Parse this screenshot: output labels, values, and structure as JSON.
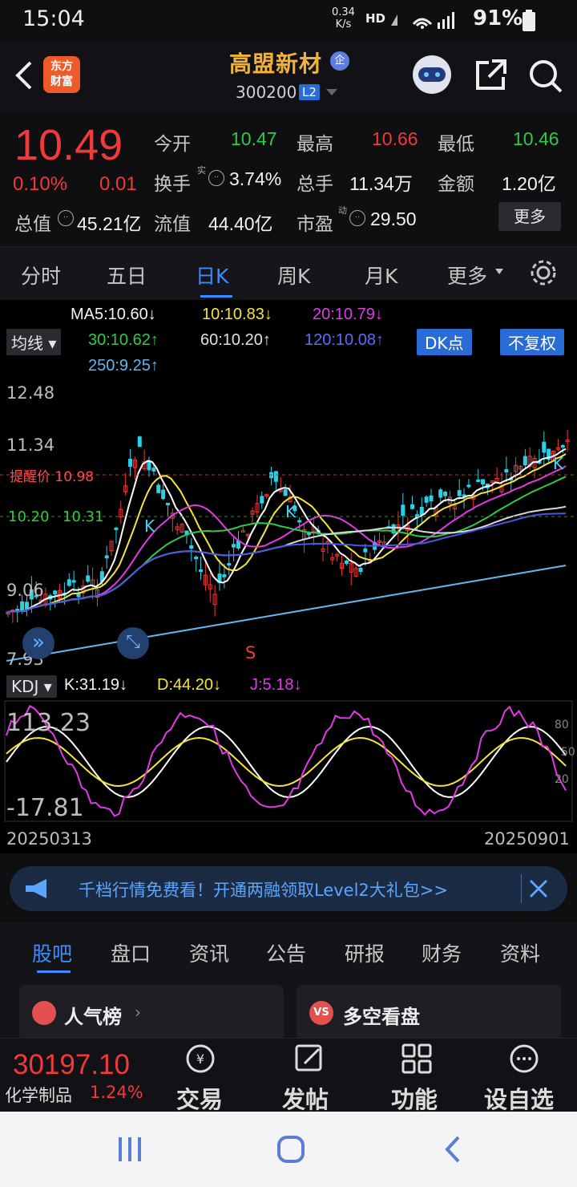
{
  "status": {
    "time": "15:04",
    "net_speed": "0.34",
    "net_unit": "K/s",
    "hd": "HD",
    "battery": "91%"
  },
  "header": {
    "brand_line1": "东方",
    "brand_line2": "财富",
    "stock_name": "高盟新材",
    "name_badge": "企",
    "stock_code": "300200",
    "l2_badge": "L2"
  },
  "quote": {
    "price": "10.49",
    "change_pct": "0.10%",
    "change": "0.01",
    "open_label": "今开",
    "open": "10.47",
    "high_label": "最高",
    "high": "10.66",
    "low_label": "最低",
    "low": "10.46",
    "turnover_label": "换手",
    "turnover_sup": "实",
    "turnover": "3.74%",
    "volume_label": "总手",
    "volume": "11.34万",
    "amount_label": "金额",
    "amount": "1.20亿",
    "mktcap_label": "总值",
    "mktcap": "45.21亿",
    "float_label": "流值",
    "float": "44.40亿",
    "pe_label": "市盈",
    "pe_sup": "动",
    "pe": "29.50",
    "more_button": "更多"
  },
  "period_tabs": [
    "分时",
    "五日",
    "日K",
    "周K",
    "月K",
    "更多"
  ],
  "ma_legend": {
    "selector": "均线",
    "ma5": "MA5:10.60↓",
    "ma10": "10:10.83↓",
    "ma20": "20:10.79↓",
    "ma30": "30:10.62↑",
    "ma60": "60:10.20↑",
    "ma120": "120:10.08↑",
    "ma250": "250:9.25↑",
    "dk_button": "DK点",
    "fq_button": "不复权"
  },
  "price_axis": {
    "p1": "12.48",
    "p2": "11.34",
    "p3": "10.20",
    "p4": "9.06",
    "p5": "7.93",
    "alert_label": "提醒价",
    "alert_value": "10.98",
    "marker_value": "10.31"
  },
  "markers": {
    "k1": "K",
    "k2": "K",
    "k3": "K",
    "s": "S"
  },
  "kdj": {
    "selector": "KDJ",
    "k": "K:31.19↓",
    "d": "D:44.20↓",
    "j": "J:5.18↓",
    "top": "113.23",
    "bottom": "-17.81",
    "r80": "80",
    "r50": "50",
    "r20": "20"
  },
  "dates": {
    "start": "20250313",
    "end": "20250901"
  },
  "banner": {
    "text": "千档行情免费看！开通两融领取Level2大礼包>>"
  },
  "info_tabs": [
    "股吧",
    "盘口",
    "资讯",
    "公告",
    "研报",
    "财务",
    "资料"
  ],
  "cards": {
    "left": "人气榜",
    "right": "多空看盘"
  },
  "index": {
    "value": "30197.10",
    "name": "化学制品",
    "pct": "1.24%"
  },
  "bottom_nav": [
    "交易",
    "发帖",
    "功能",
    "设自选"
  ],
  "colors": {
    "up": "#f03a3a",
    "down": "#2ccc47",
    "accent": "#3c8cff",
    "brand": "#ef5a2a",
    "name": "#f2b23a"
  },
  "chart_data": {
    "type": "line",
    "title": "",
    "x_start": "20250313",
    "x_end": "20250901",
    "ylim": [
      7.93,
      12.48
    ],
    "yticks": [
      12.48,
      11.34,
      10.2,
      9.06,
      7.93
    ],
    "series": [
      {
        "name": "MA5",
        "last": 10.6,
        "color": "#ffffff"
      },
      {
        "name": "10",
        "last": 10.83,
        "color": "#f5e53a"
      },
      {
        "name": "20",
        "last": 10.79,
        "color": "#e23ae6"
      },
      {
        "name": "30",
        "last": 10.62,
        "color": "#2ccc47"
      },
      {
        "name": "60",
        "last": 10.2,
        "color": "#d8d8d8"
      },
      {
        "name": "120",
        "last": 10.08,
        "color": "#4a58e0"
      },
      {
        "name": "250",
        "last": 9.25,
        "color": "#62b6f0"
      }
    ],
    "kdj": {
      "K": 31.19,
      "D": 44.2,
      "J": 5.18,
      "ylim": [
        -17.81,
        113.23
      ]
    }
  }
}
